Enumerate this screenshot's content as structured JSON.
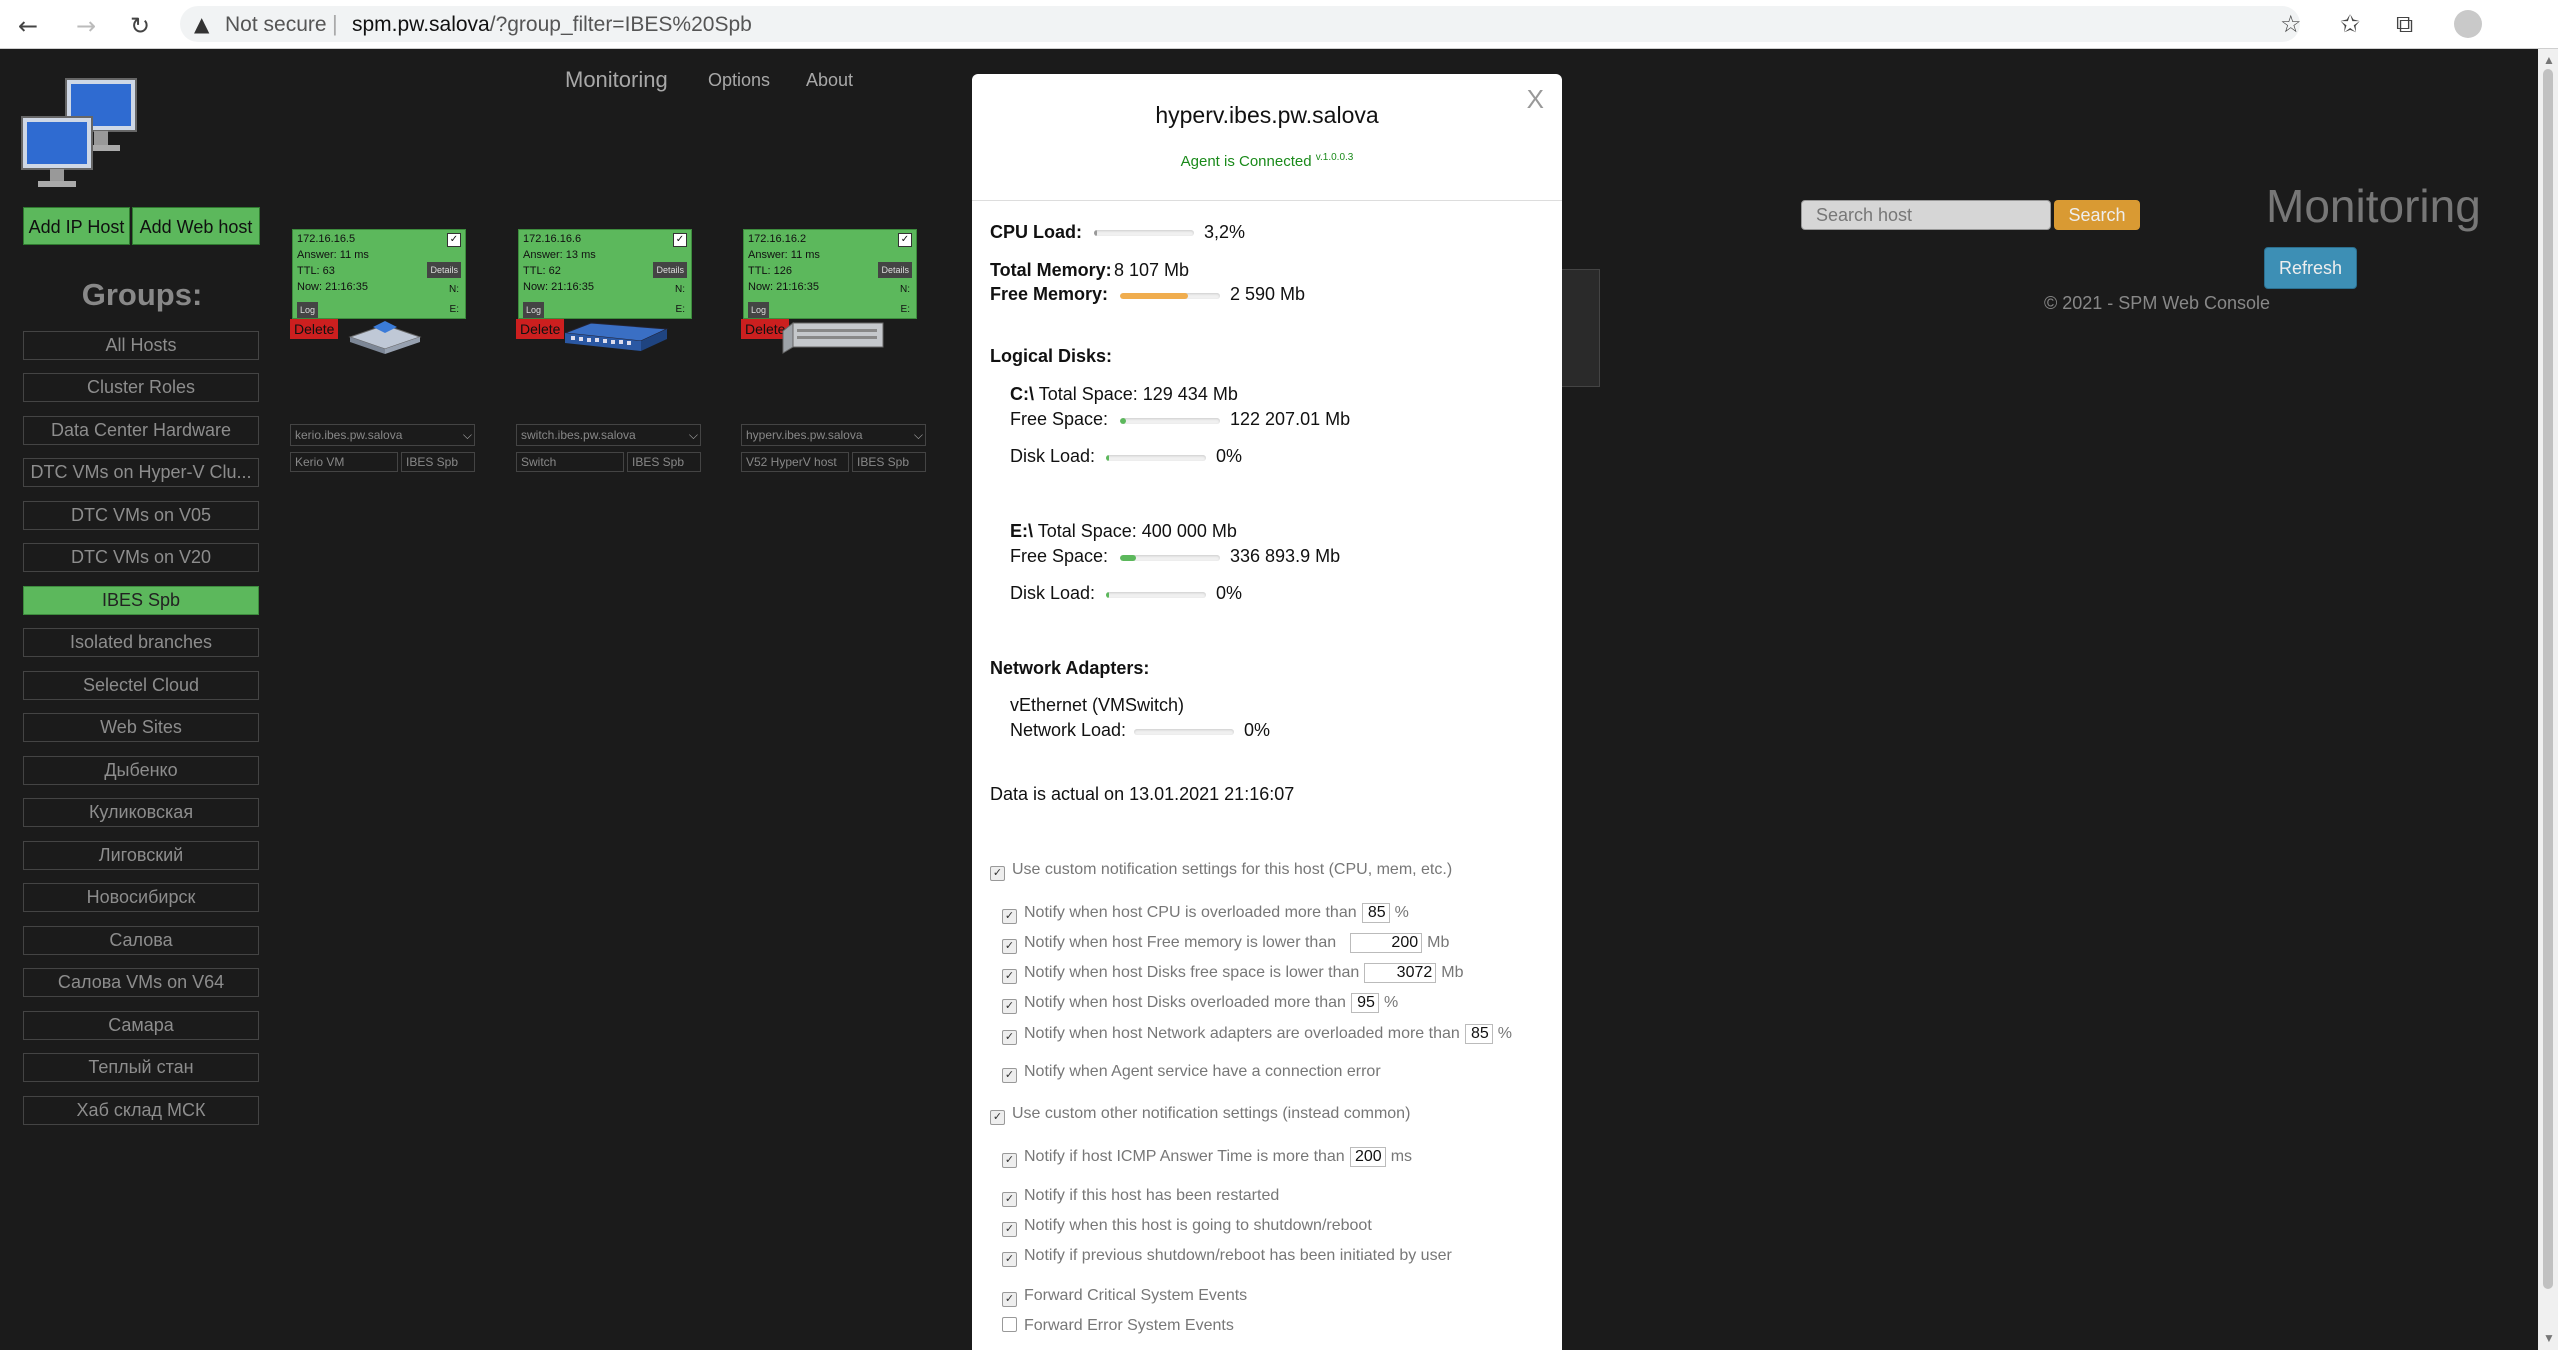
{
  "browser": {
    "back_icon": "←",
    "forward_icon": "→",
    "reload_icon": "↻",
    "not_secure": "Not secure",
    "url_domain": "spm.pw.salova",
    "url_path": "/?group_filter=IBES%20Spb",
    "star_icon": "☆",
    "favorites_icon": "✩",
    "collections_icon": "⧉"
  },
  "nav": {
    "monitoring": "Monitoring",
    "options": "Options",
    "about": "About"
  },
  "actions": {
    "add_ip_host": "Add IP Host",
    "add_web_host": "Add Web host"
  },
  "groups": {
    "title": "Groups:",
    "items": [
      "All Hosts",
      "Cluster Roles",
      "Data Center Hardware",
      "DTC VMs on Hyper-V Clu...",
      "DTC VMs on V05",
      "DTC VMs on V20",
      "IBES Spb",
      "Isolated branches",
      "Selectel Cloud",
      "Web Sites",
      "Дыбенко",
      "Куликовская",
      "Лиговский",
      "Новосибирск",
      "Салова",
      "Салова VMs on V64",
      "Самара",
      "Теплый стан",
      "Хаб склад МСК"
    ],
    "active": "IBES Spb"
  },
  "hosts": [
    {
      "ip": "172.16.16.5",
      "answer": "Answer: 11 ms",
      "ttl": "TTL: 63",
      "now": "Now: 21:16:35",
      "details": "Details",
      "n": "N:",
      "log": "Log",
      "e": "E:",
      "delete": "Delete",
      "name": "kerio.ibes.pw.salova",
      "desc": "Kerio VM",
      "group": "IBES Spb"
    },
    {
      "ip": "172.16.16.6",
      "answer": "Answer: 13 ms",
      "ttl": "TTL: 62",
      "now": "Now: 21:16:35",
      "details": "Details",
      "n": "N:",
      "log": "Log",
      "e": "E:",
      "delete": "Delete",
      "name": "switch.ibes.pw.salova",
      "desc": "Switch",
      "group": "IBES Spb"
    },
    {
      "ip": "172.16.16.2",
      "answer": "Answer: 11 ms",
      "ttl": "TTL: 126",
      "now": "Now: 21:16:35",
      "details": "Details",
      "n": "N:",
      "log": "Log",
      "e": "E:",
      "delete": "Delete",
      "name": "hyperv.ibes.pw.salova",
      "desc": "V52 HyperV host",
      "group": "IBES Spb"
    }
  ],
  "search": {
    "placeholder": "Search host",
    "button": "Search"
  },
  "right": {
    "title": "Monitoring",
    "refresh": "Refresh",
    "copyright": "© 2021 - SPM Web Console"
  },
  "modal": {
    "close": "X",
    "host": "hyperv.ibes.pw.salova",
    "agent_status": "Agent is Connected",
    "agent_version": "v.1.0.0.3",
    "cpu_label": "CPU Load:",
    "cpu_value": "3,2%",
    "cpu_fraction": 0.032,
    "total_mem_label": "Total Memory:",
    "total_mem_value": "8 107 Mb",
    "free_mem_label": "Free Memory:",
    "free_mem_value": "2 590 Mb",
    "free_mem_fraction": 0.68,
    "disks_title": "Logical Disks:",
    "disks": [
      {
        "letter": "C:\\",
        "total_label": "Total Space:",
        "total": "129 434 Mb",
        "free_label": "Free Space:",
        "free": "122 207.01 Mb",
        "free_fraction": 0.06,
        "load_label": "Disk Load:",
        "load": "0%",
        "load_fraction": 0
      },
      {
        "letter": "E:\\",
        "total_label": "Total Space:",
        "total": "400 000 Mb",
        "free_label": "Free Space:",
        "free": "336 893.9 Mb",
        "free_fraction": 0.16,
        "load_label": "Disk Load:",
        "load": "0%",
        "load_fraction": 0
      }
    ],
    "net_title": "Network Adapters:",
    "adapter_name": "vEthernet (VMSwitch)",
    "net_load_label": "Network Load:",
    "net_load": "0%",
    "actual": "Data is actual on 13.01.2021 21:16:07",
    "custom_notif": "Use custom notification settings for this host (CPU, mem, etc.)",
    "cpu_notif": "Notify when host CPU is overloaded more than",
    "cpu_notif_val": "85",
    "cpu_notif_unit": "%",
    "mem_notif": "Notify when host Free memory is lower than",
    "mem_notif_val": "200",
    "mem_notif_unit": "Mb",
    "disk_free_notif": "Notify when host Disks free space is lower than",
    "disk_free_notif_val": "3072",
    "disk_free_notif_unit": "Mb",
    "disk_load_notif": "Notify when host Disks overloaded more than",
    "disk_load_notif_val": "95",
    "disk_load_notif_unit": "%",
    "net_notif": "Notify when host Network adapters are overloaded more than",
    "net_notif_val": "85",
    "net_notif_unit": "%",
    "agent_err_notif": "Notify when Agent service have a connection error",
    "custom_other": "Use custom other notification settings (instead common)",
    "icmp_notif": "Notify if host ICMP Answer Time is more than",
    "icmp_notif_val": "200",
    "icmp_notif_unit": "ms",
    "restart_notif": "Notify if this host has been restarted",
    "shutdown_notif": "Notify when this host is going to shutdown/reboot",
    "user_shutdown_notif": "Notify if previous shutdown/reboot has been initiated by user",
    "fwd_critical": "Forward Critical System Events",
    "fwd_error": "Forward Error System Events"
  },
  "colors": {
    "green": "#5cb85c",
    "orange": "#f0ad4e",
    "delete_red": "#cc1f1f",
    "agent_green": "#1a8a1a",
    "refresh_blue": "#3d8fb5",
    "search_orange": "#d99a33"
  }
}
